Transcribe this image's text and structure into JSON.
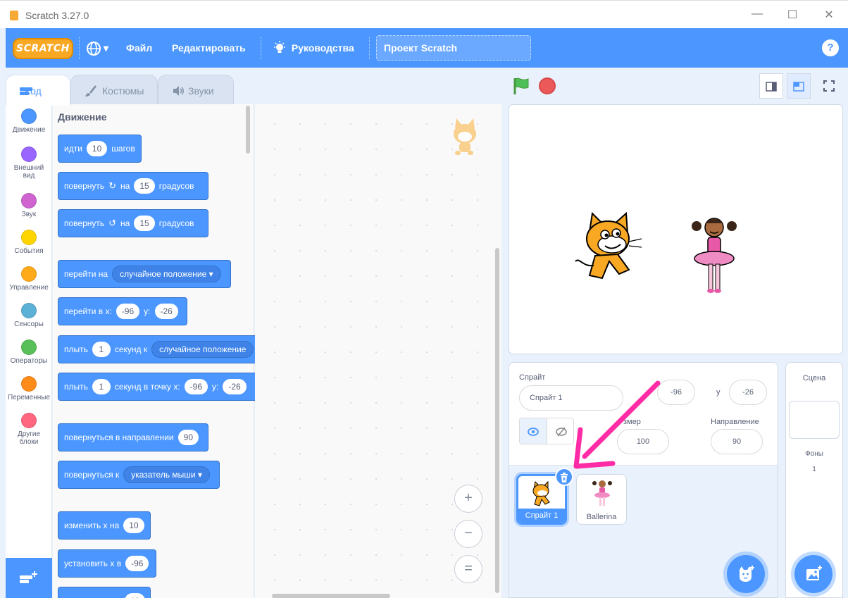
{
  "window": {
    "title": "Scratch 3.27.0",
    "corner_fragment": "к.",
    "controls": {
      "minimize": "—",
      "maximize": "☐",
      "close": "✕"
    }
  },
  "menu": {
    "logo": "SCRATCH",
    "language_arrow": "▾",
    "file": "Файл",
    "edit": "Редактировать",
    "tutorials": "Руководства",
    "project_title": "Проект Scratch",
    "help": "?"
  },
  "tabs": [
    {
      "label": "Код",
      "icon": "code-icon",
      "active": true
    },
    {
      "label": "Костюмы",
      "icon": "brush-icon",
      "active": false
    },
    {
      "label": "Звуки",
      "icon": "speaker-icon",
      "active": false
    }
  ],
  "categories": [
    {
      "label": "Движение",
      "color": "#4c97ff"
    },
    {
      "label": "Внешний вид",
      "color": "#9966ff"
    },
    {
      "label": "Звук",
      "color": "#cf63cf"
    },
    {
      "label": "События",
      "color": "#ffd500"
    },
    {
      "label": "Управление",
      "color": "#ffab19"
    },
    {
      "label": "Сенсоры",
      "color": "#5cb1d6"
    },
    {
      "label": "Операторы",
      "color": "#59c059"
    },
    {
      "label": "Переменные",
      "color": "#ff8c1a"
    },
    {
      "label": "Другие блоки",
      "color": "#ff6680"
    }
  ],
  "palette": {
    "heading": "Движение",
    "blocks": {
      "move": {
        "a": "идти",
        "steps": "10",
        "b": "шагов"
      },
      "turn_right": {
        "a": "повернуть",
        "b": "на",
        "deg": "15",
        "c": "градусов",
        "glyph": "↻"
      },
      "turn_left": {
        "a": "повернуть",
        "b": "на",
        "deg": "15",
        "c": "градусов",
        "glyph": "↺"
      },
      "goto": {
        "a": "перейти на",
        "target": "случайное положение"
      },
      "goto_xy": {
        "a": "перейти в x:",
        "x": "-96",
        "b": "y:",
        "y": "-26"
      },
      "glide_to": {
        "a": "плыть",
        "secs": "1",
        "b": "секунд к",
        "target": "случайное положение"
      },
      "glide_xy": {
        "a": "плыть",
        "secs": "1",
        "b": "секунд в точку x:",
        "x": "-96",
        "c": "y:",
        "y": "-26"
      },
      "point_dir": {
        "a": "повернуться в направлении",
        "dir": "90"
      },
      "point_towards": {
        "a": "повернуться к",
        "target": "указатель мыши"
      },
      "change_x": {
        "a": "изменить х на",
        "val": "10"
      },
      "set_x": {
        "a": "установить х в",
        "val": "-96"
      },
      "partial": {
        "val": "10"
      }
    }
  },
  "zoom": {
    "in": "+",
    "out": "−",
    "reset": "="
  },
  "sprite_info": {
    "sprite_label": "Спрайт",
    "sprite_name": "Спрайт 1",
    "x_value": "-96",
    "y_label": "y",
    "y_value": "-26",
    "size_label": "змер",
    "size_value": "100",
    "direction_label": "Направление",
    "direction_value": "90"
  },
  "sprites": [
    {
      "name": "Спрайт 1",
      "selected": true
    },
    {
      "name": "Ballerina",
      "selected": false
    }
  ],
  "scene": {
    "label": "Сцена",
    "backdrops_label": "Фоны",
    "backdrops_count": "1"
  },
  "colors": {
    "menu_blue": "#4c97ff",
    "annotation": "#ff2ba6",
    "stop": "#ec5959",
    "flag": "#4cbf56"
  }
}
